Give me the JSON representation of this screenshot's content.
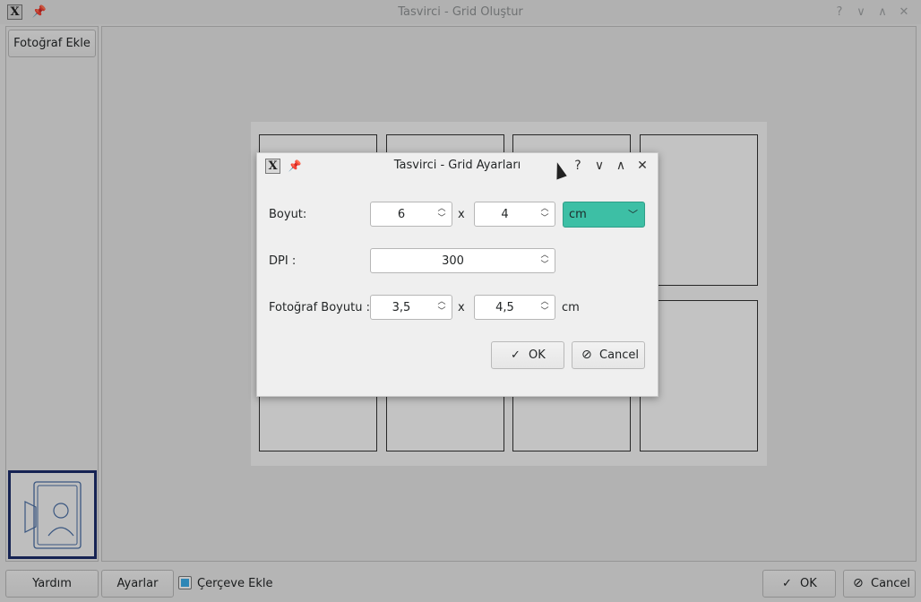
{
  "window": {
    "title": "Tasvirci - Grid Oluştur",
    "app_icon": "X",
    "buttons": {
      "help": "?",
      "minimize": "∨",
      "maximize": "∧",
      "close": "✕"
    }
  },
  "sidebar": {
    "add_photo_label": "Fotoğraf Ekle"
  },
  "footer": {
    "help_label": "Yardım",
    "settings_label": "Ayarlar",
    "frame_checkbox_label": "Çerçeve Ekle",
    "frame_checked": true,
    "ok_label": "OK",
    "cancel_label": "Cancel"
  },
  "dialog": {
    "title": "Tasvirci - Grid Ayarları",
    "buttons": {
      "help": "?",
      "minimize": "∨",
      "maximize": "∧",
      "close": "✕"
    },
    "size_label": "Boyut:",
    "size_w": "6",
    "size_h": "4",
    "times": "x",
    "unit": "cm",
    "dpi_label": "DPI :",
    "dpi": "300",
    "photo_size_label": "Fotoğraf Boyutu :",
    "photo_w": "3,5",
    "photo_h": "4,5",
    "photo_unit": "cm",
    "ok_label": "OK",
    "cancel_label": "Cancel"
  },
  "colors": {
    "accent": "#3dbfa5",
    "thumb_border": "#1d2d6b"
  }
}
